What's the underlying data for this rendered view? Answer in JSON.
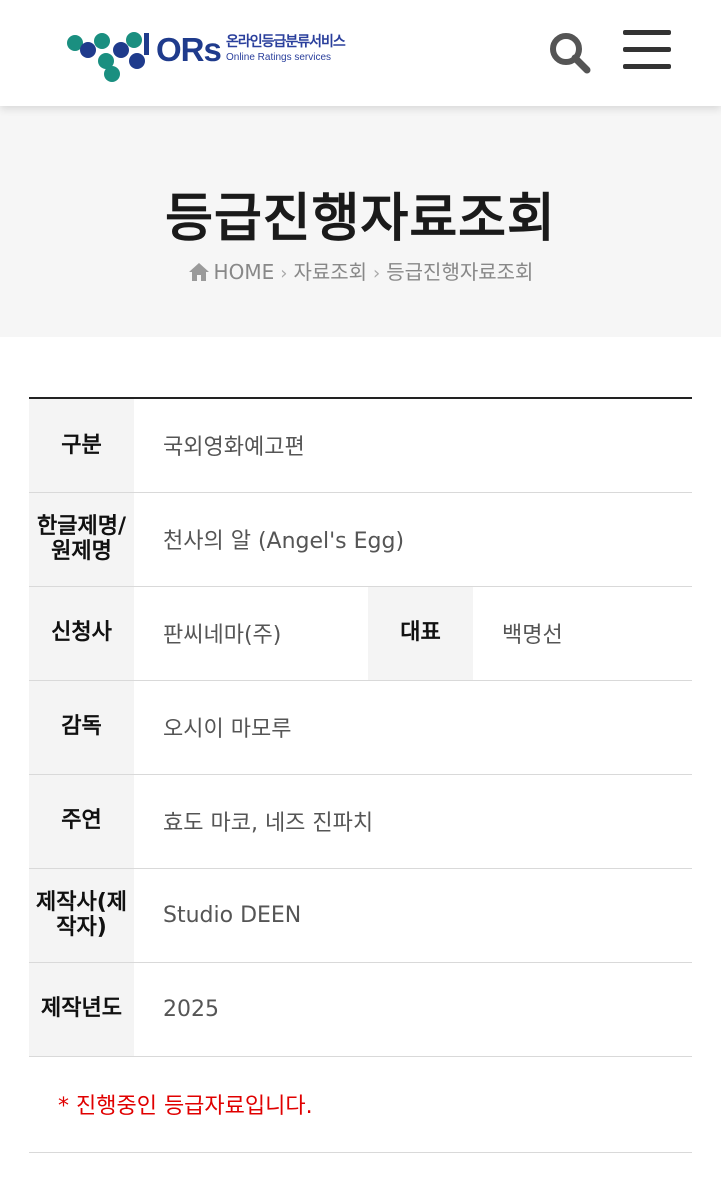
{
  "header": {
    "logo_mark": "ORs",
    "logo_mark_suffix": "s",
    "logo_ko": "온라인등급분류서비스",
    "logo_en": "Online Ratings services",
    "search_icon": "search-icon",
    "menu_icon": "hamburger-menu-icon"
  },
  "hero": {
    "title": "등급진행자료조회",
    "breadcrumb": [
      "HOME",
      "자료조회",
      "등급진행자료조회"
    ]
  },
  "table": {
    "rows": [
      {
        "label": "구분",
        "value": "국외영화예고편"
      },
      {
        "label": "한글제명/원제명",
        "value": "천사의 알  (Angel's Egg)"
      },
      {
        "label": "신청사",
        "value": "판씨네마(주)",
        "label2": "대표",
        "value2": "백명선"
      },
      {
        "label": "감독",
        "value": "오시이 마모루"
      },
      {
        "label": "주연",
        "value": "효도 마코, 네즈 진파치"
      },
      {
        "label": "제작사(제작자)",
        "value": "Studio DEEN"
      },
      {
        "label": "제작년도",
        "value": "2025"
      }
    ],
    "notice": "* 진행중인 등급자료입니다."
  },
  "colors": {
    "brand_blue": "#1f3b8c",
    "brand_teal": "#1a8f80",
    "notice_red": "#e00000"
  }
}
